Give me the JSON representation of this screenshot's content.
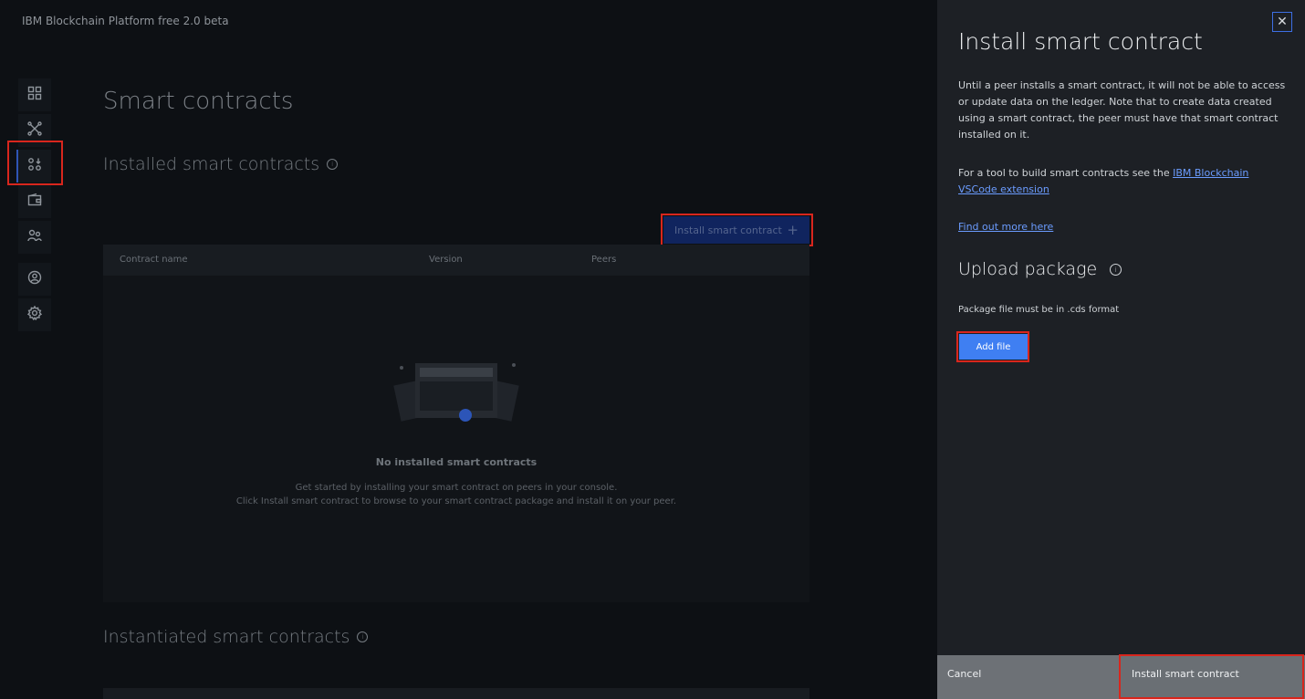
{
  "app": {
    "title": "IBM Blockchain Platform free 2.0 beta"
  },
  "nav": {
    "items": [
      {
        "name": "dashboard",
        "icon": "grid-icon"
      },
      {
        "name": "channels",
        "icon": "network-icon"
      },
      {
        "name": "smart-contracts",
        "icon": "smart-contracts-icon",
        "active": true
      },
      {
        "name": "wallet",
        "icon": "wallet-icon"
      },
      {
        "name": "users",
        "icon": "users-icon"
      },
      {
        "name": "profile",
        "icon": "user-icon"
      },
      {
        "name": "settings",
        "icon": "gear-icon"
      }
    ]
  },
  "main": {
    "page_title": "Smart contracts",
    "installed": {
      "title": "Installed smart contracts",
      "install_button": "Install smart contract",
      "columns": [
        "Contract name",
        "Version",
        "Peers"
      ],
      "empty_title": "No installed smart contracts",
      "empty_desc_1": "Get started by installing your smart contract on peers in your console.",
      "empty_desc_2": "Click Install smart contract to browse to your smart contract package and install it on your peer."
    },
    "instantiated": {
      "title": "Instantiated smart contracts"
    }
  },
  "panel": {
    "title": "Install smart contract",
    "intro": "Until a peer installs a smart contract, it will not be able to access or update data on the ledger. Note that to create data created using a smart contract, the peer must have that smart contract installed on it.",
    "tool_prefix": "For a tool to build smart contracts see the ",
    "tool_link": "IBM Blockchain VSCode extension",
    "find_out_more": "Find out more here",
    "upload_title": "Upload package",
    "package_note": "Package file must be in .cds format",
    "add_file": "Add file",
    "cancel": "Cancel",
    "submit": "Install smart contract"
  },
  "colors": {
    "accent": "#3f7ff2",
    "highlight": "#d8261d",
    "panel_bg": "#1d2025"
  }
}
